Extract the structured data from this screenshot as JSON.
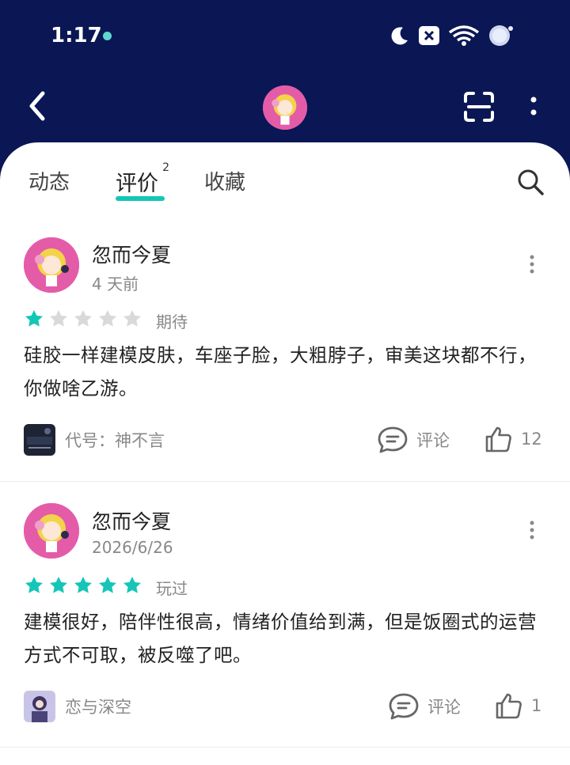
{
  "status_bar": {
    "time": "1:17"
  },
  "tabs": [
    {
      "label": "动态"
    },
    {
      "label": "评价",
      "badge": "2"
    },
    {
      "label": "收藏"
    }
  ],
  "colors": {
    "header_bg": "#0b1654",
    "accent": "#14c6b7",
    "star_filled": "#14c6b7",
    "star_empty": "#d9d9d9"
  },
  "icons": {
    "back": "back-arrow-icon",
    "scan": "scan-icon",
    "more": "more-vertical-icon",
    "search": "search-icon",
    "comment": "comment-icon",
    "like": "thumbs-up-icon"
  },
  "reviews": [
    {
      "author": "忽而今夏",
      "date": "4 天前",
      "rating": 1,
      "status": "期待",
      "content": "硅胶一样建模皮肤，车座子脸，大粗脖子，审美这块都不行，你做啥乙游。",
      "game": "代号：神不言",
      "comment_label": "评论",
      "likes": "12"
    },
    {
      "author": "忽而今夏",
      "date": "2026/6/26",
      "rating": 5,
      "status": "玩过",
      "content": "建模很好，陪伴性很高，情绪价值给到满，但是饭圈式的运营方式不可取，被反噬了吧。",
      "game": "恋与深空",
      "comment_label": "评论",
      "likes": "1"
    }
  ]
}
